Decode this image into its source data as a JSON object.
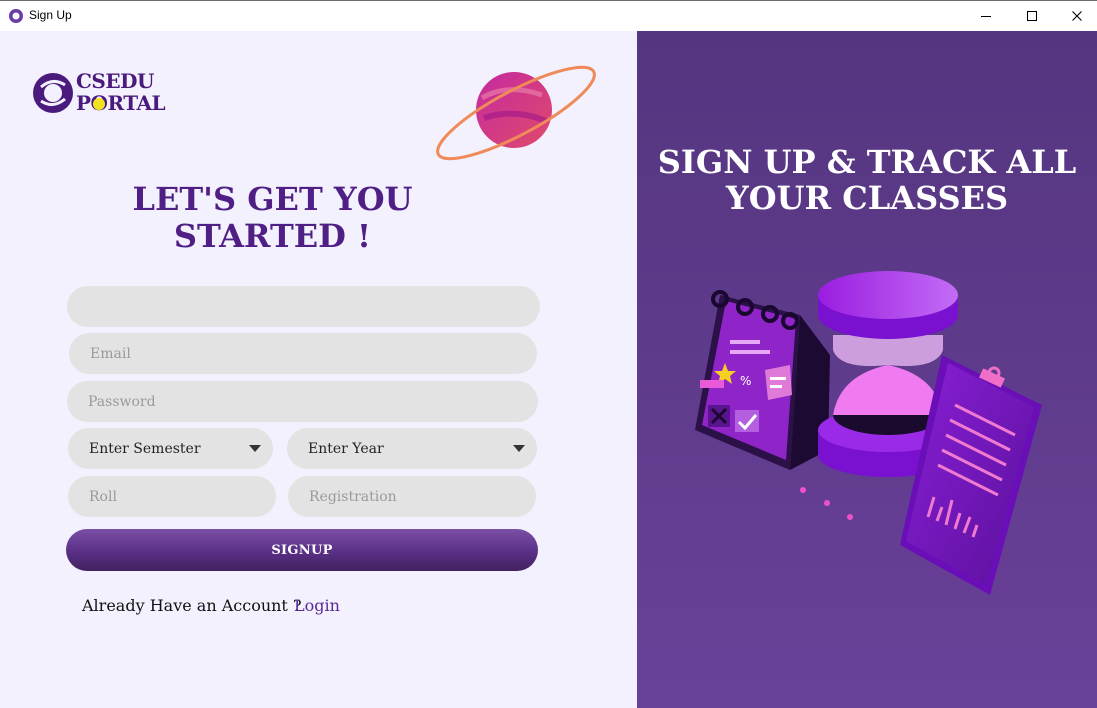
{
  "window": {
    "title": "Sign Up"
  },
  "logo": {
    "line1": "CSEDU",
    "line2": "PORTAL"
  },
  "form": {
    "heading_line1": "LET'S GET YOU",
    "heading_line2": "STARTED !",
    "name_value": "",
    "email_placeholder": "Email",
    "password_placeholder": "Password",
    "semester_selected": "Enter Semester",
    "year_selected": "Enter Year",
    "roll_placeholder": "Roll",
    "registration_placeholder": "Registration",
    "signup_label": "SIGNUP",
    "already_text": "Already Have an Account ?",
    "login_label": "Login"
  },
  "hero": {
    "title_line1": "SIGN UP & TRACK ALL",
    "title_line2": "YOUR CLASSES"
  },
  "colors": {
    "left_bg": "#f2f1fd",
    "right_bg": "#5d3a8b",
    "accent": "#4f1f86",
    "field_bg": "#e3e3e3"
  }
}
